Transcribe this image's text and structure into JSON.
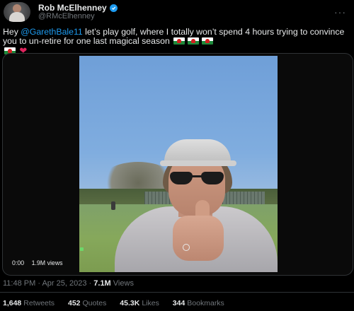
{
  "author": {
    "name": "Rob McElhenney",
    "handle": "@RMcElhenney",
    "verified": true
  },
  "tweet": {
    "text_prefix": "Hey ",
    "mention": "@GarethBale11",
    "text_body": " let’s play golf, where I totally won’t spend 4 hours trying to convince you to un-retire for one last magical season",
    "trailing_emoji": [
      "wales-flag-icon",
      "wales-flag-icon",
      "wales-flag-icon",
      "wales-flag-icon",
      "red-heart-icon"
    ]
  },
  "video": {
    "current_time": "0:00",
    "views": "1.9M views"
  },
  "meta": {
    "time": "11:48 PM",
    "separator": "·",
    "date": "Apr 25, 2023",
    "views_count": "7.1M",
    "views_label": "Views"
  },
  "stats": {
    "retweets_count": "1,648",
    "retweets_label": "Retweets",
    "quotes_count": "452",
    "quotes_label": "Quotes",
    "likes_count": "45.3K",
    "likes_label": "Likes",
    "bookmarks_count": "344",
    "bookmarks_label": "Bookmarks"
  },
  "colors": {
    "background": "#000000",
    "text": "#e7e9ea",
    "muted": "#71767b",
    "accent": "#1d9bf0",
    "heart": "#e0245e"
  }
}
